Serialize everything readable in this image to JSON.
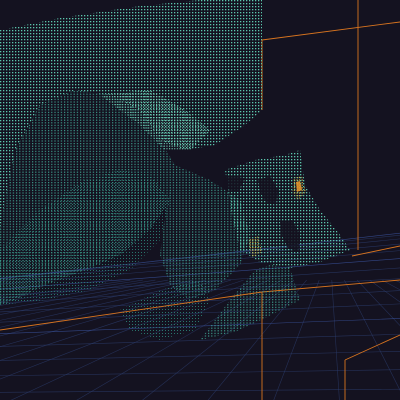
{
  "viewer": {
    "kind": "3d-point-cloud-viewport",
    "colors": {
      "background": "#141220",
      "ground_grid": "#2c3d6e",
      "ground_grid_bright": "#3d58a8",
      "bounding_box": "#d8741f",
      "cloud_primary": "#5fd0b4",
      "cloud_dark": "#1f6f66",
      "cloud_shadow": "#245b5e",
      "cloud_highlight": "#a8eed8",
      "cloud_accent_yellow": "#e0c04a",
      "cloud_accent_orange": "#e0902a"
    }
  }
}
